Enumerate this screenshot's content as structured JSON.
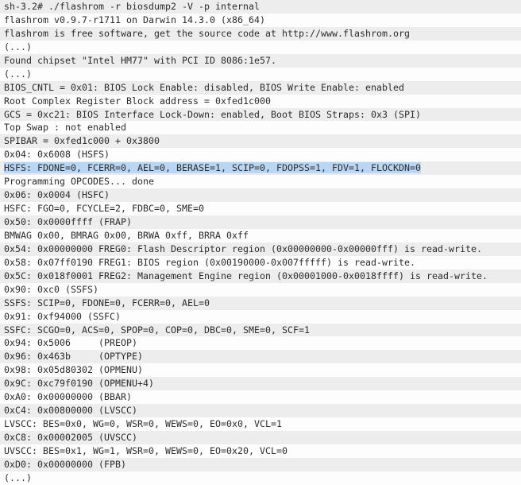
{
  "terminal": {
    "prompt": "sh-3.2#",
    "command": "./flashrom -r biosdump2 -V -p internal",
    "selection_color": "#b9d7f4",
    "stripe_color": "#ededed",
    "background_color": "#fdfdfd",
    "text_color": "#2b2b2b",
    "lines": [
      {
        "text": "sh-3.2# ./flashrom -r biosdump2 -V -p internal",
        "selected": false
      },
      {
        "text": "flashrom v0.9.7-r1711 on Darwin 14.3.0 (x86_64)",
        "selected": false
      },
      {
        "text": "flashrom is free software, get the source code at http://www.flashrom.org",
        "selected": false
      },
      {
        "text": "(...)",
        "selected": false
      },
      {
        "text": "Found chipset \"Intel HM77\" with PCI ID 8086:1e57.",
        "selected": false
      },
      {
        "text": "(...)",
        "selected": false
      },
      {
        "text": "BIOS_CNTL = 0x01: BIOS Lock Enable: disabled, BIOS Write Enable: enabled",
        "selected": false
      },
      {
        "text": "Root Complex Register Block address = 0xfed1c000",
        "selected": false
      },
      {
        "text": "GCS = 0xc21: BIOS Interface Lock-Down: enabled, Boot BIOS Straps: 0x3 (SPI)",
        "selected": false
      },
      {
        "text": "Top Swap : not enabled",
        "selected": false
      },
      {
        "text": "SPIBAR = 0xfed1c000 + 0x3800",
        "selected": false
      },
      {
        "text": "0x04: 0x6008 (HSFS)",
        "selected": false
      },
      {
        "text": "HSFS: FDONE=0, FCERR=0, AEL=0, BERASE=1, SCIP=0, FDOPSS=1, FDV=1, FLOCKDN=0",
        "selected": true
      },
      {
        "text": "Programming OPCODES... done",
        "selected": false
      },
      {
        "text": "0x06: 0x0004 (HSFC)",
        "selected": false
      },
      {
        "text": "HSFC: FGO=0, FCYCLE=2, FDBC=0, SME=0",
        "selected": false
      },
      {
        "text": "0x50: 0x0000ffff (FRAP)",
        "selected": false
      },
      {
        "text": "BMWAG 0x00, BMRAG 0x00, BRWA 0xff, BRRA 0xff",
        "selected": false
      },
      {
        "text": "0x54: 0x00000000 FREG0: Flash Descriptor region (0x00000000-0x00000fff) is read-write.",
        "selected": false
      },
      {
        "text": "0x58: 0x07ff0190 FREG1: BIOS region (0x00190000-0x007fffff) is read-write.",
        "selected": false
      },
      {
        "text": "0x5C: 0x018f0001 FREG2: Management Engine region (0x00001000-0x0018ffff) is read-write.",
        "selected": false
      },
      {
        "text": "0x90: 0xc0 (SSFS)",
        "selected": false
      },
      {
        "text": "SSFS: SCIP=0, FDONE=0, FCERR=0, AEL=0",
        "selected": false
      },
      {
        "text": "0x91: 0xf94000 (SSFC)",
        "selected": false
      },
      {
        "text": "SSFC: SCGO=0, ACS=0, SPOP=0, COP=0, DBC=0, SME=0, SCF=1",
        "selected": false
      },
      {
        "text": "0x94: 0x5006     (PREOP)",
        "selected": false
      },
      {
        "text": "0x96: 0x463b     (OPTYPE)",
        "selected": false
      },
      {
        "text": "0x98: 0x05d80302 (OPMENU)",
        "selected": false
      },
      {
        "text": "0x9C: 0xc79f0190 (OPMENU+4)",
        "selected": false
      },
      {
        "text": "0xA0: 0x00000000 (BBAR)",
        "selected": false
      },
      {
        "text": "0xC4: 0x00800000 (LVSCC)",
        "selected": false
      },
      {
        "text": "LVSCC: BES=0x0, WG=0, WSR=0, WEWS=0, EO=0x0, VCL=1",
        "selected": false
      },
      {
        "text": "0xC8: 0x00002005 (UVSCC)",
        "selected": false
      },
      {
        "text": "UVSCC: BES=0x1, WG=1, WSR=0, WEWS=0, EO=0x20, VCL=0",
        "selected": false
      },
      {
        "text": "0xD0: 0x00000000 (FPB)",
        "selected": false
      },
      {
        "text": "(...)",
        "selected": false
      }
    ]
  }
}
